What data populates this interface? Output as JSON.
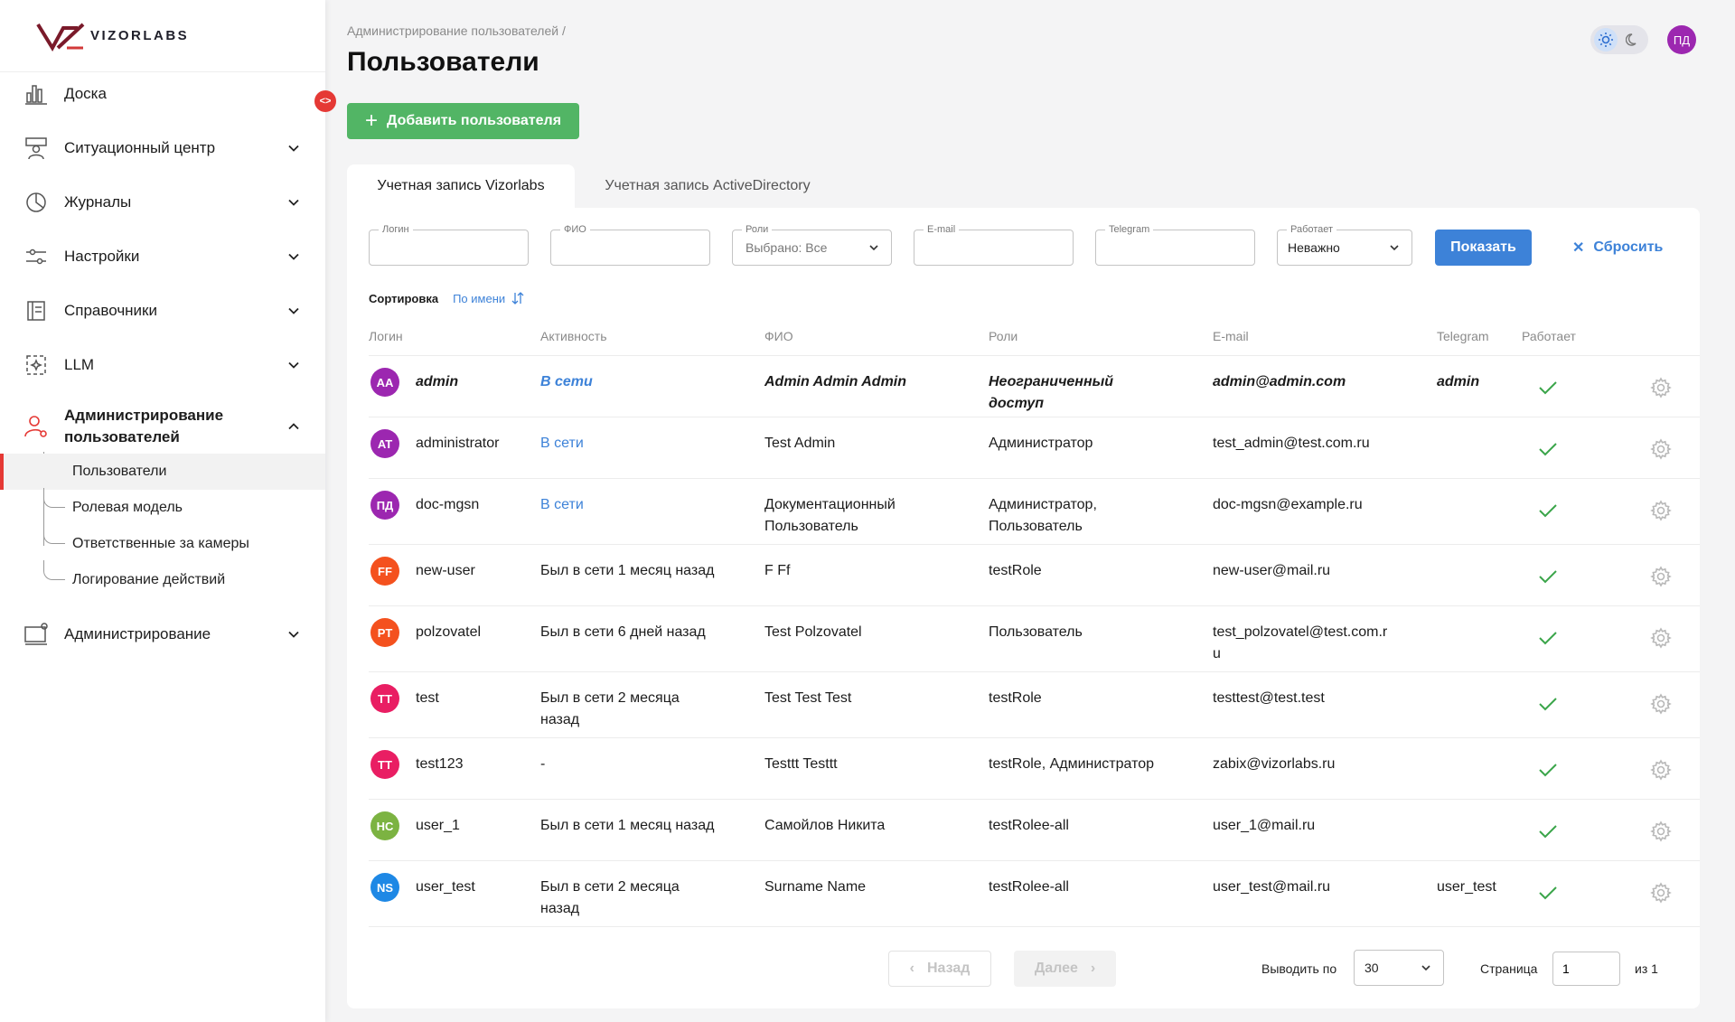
{
  "app": {
    "logo_text": "VIZORLABS",
    "user_initials": "ПД"
  },
  "sidebar": {
    "items": [
      {
        "label": "Доска"
      },
      {
        "label": "Ситуационный центр"
      },
      {
        "label": "Журналы"
      },
      {
        "label": "Настройки"
      },
      {
        "label": "Справочники"
      },
      {
        "label": "LLM"
      },
      {
        "label": "Администрирование пользователей"
      },
      {
        "label": "Администрирование"
      }
    ],
    "subitems": [
      {
        "label": "Пользователи"
      },
      {
        "label": "Ролевая модель"
      },
      {
        "label": "Ответственные за камеры"
      },
      {
        "label": "Логирование действий"
      }
    ],
    "collapse_glyph": "<>"
  },
  "header": {
    "breadcrumb": "Администрирование пользователей /",
    "title": "Пользователи",
    "add_button": "Добавить пользователя"
  },
  "tabs": [
    {
      "label": "Учетная запись Vizorlabs"
    },
    {
      "label": "Учетная запись ActiveDirectory"
    }
  ],
  "filters": {
    "login": {
      "label": "Логин",
      "value": ""
    },
    "fio": {
      "label": "ФИО",
      "value": ""
    },
    "roles": {
      "label": "Роли",
      "value": "Выбрано: Все"
    },
    "email": {
      "label": "E-mail",
      "value": ""
    },
    "telegram": {
      "label": "Telegram",
      "value": ""
    },
    "works": {
      "label": "Работает",
      "value": "Неважно"
    },
    "show_button": "Показать",
    "reset_button": "Сбросить"
  },
  "sort": {
    "label": "Сортировка",
    "value": "По имени"
  },
  "table": {
    "columns": [
      "Логин",
      "Активность",
      "ФИО",
      "Роли",
      "E-mail",
      "Telegram",
      "Работает"
    ],
    "rows": [
      {
        "initials": "AA",
        "avatar_color": "#9c27b0",
        "login": "admin",
        "activity": "В сети",
        "online": true,
        "fio": "Admin Admin Admin",
        "roles": "Неограниченный доступ",
        "email": "admin@admin.com",
        "telegram": "admin",
        "works": true
      },
      {
        "initials": "AT",
        "avatar_color": "#9c27b0",
        "login": "administrator",
        "activity": "В сети",
        "online": true,
        "fio": "Test Admin",
        "roles": "Администратор",
        "email": "test_admin@test.com.ru",
        "telegram": "",
        "works": true
      },
      {
        "initials": "ПД",
        "avatar_color": "#9c27b0",
        "login": "doc-mgsn",
        "activity": "В сети",
        "online": true,
        "fio": "Документационный Пользователь",
        "roles": "Администратор, Пользователь",
        "email": "doc-mgsn@example.ru",
        "telegram": "",
        "works": true
      },
      {
        "initials": "FF",
        "avatar_color": "#f4511e",
        "login": "new-user",
        "activity": "Был в сети 1 месяц назад",
        "online": false,
        "fio": "F Ff",
        "roles": "testRole",
        "email": "new-user@mail.ru",
        "telegram": "",
        "works": true
      },
      {
        "initials": "PT",
        "avatar_color": "#f4511e",
        "login": "polzovatel",
        "activity": "Был в сети 6 дней назад",
        "online": false,
        "fio": "Test Polzovatel",
        "roles": "Пользователь",
        "email": "test_polzovatel@test.com.ru",
        "telegram": "",
        "works": true
      },
      {
        "initials": "TT",
        "avatar_color": "#e91e63",
        "login": "test",
        "activity": "Был в сети 2 месяца назад",
        "online": false,
        "fio": "Test Test Test",
        "roles": "testRole",
        "email": "testtest@test.test",
        "telegram": "",
        "works": true
      },
      {
        "initials": "TT",
        "avatar_color": "#e91e63",
        "login": "test123",
        "activity": "-",
        "online": false,
        "fio": "Testtt Testtt",
        "roles": "testRole, Администратор",
        "email": "zabix@vizorlabs.ru",
        "telegram": "",
        "works": true
      },
      {
        "initials": "HC",
        "avatar_color": "#7cb342",
        "login": "user_1",
        "activity": "Был в сети 1 месяц назад",
        "online": false,
        "fio": "Самойлов Никита",
        "roles": "testRolee-all",
        "email": "user_1@mail.ru",
        "telegram": "",
        "works": true
      },
      {
        "initials": "NS",
        "avatar_color": "#1e88e5",
        "login": "user_test",
        "activity": "Был в сети 2 месяца назад",
        "online": false,
        "fio": "Surname Name",
        "roles": "testRolee-all",
        "email": "user_test@mail.ru",
        "telegram": "user_test",
        "works": true
      }
    ]
  },
  "pagination": {
    "prev": "Назад",
    "next": "Далее",
    "per_page_label": "Выводить по",
    "per_page_value": "30",
    "page_label": "Страница",
    "page_value": "1",
    "of_label": "из 1"
  }
}
